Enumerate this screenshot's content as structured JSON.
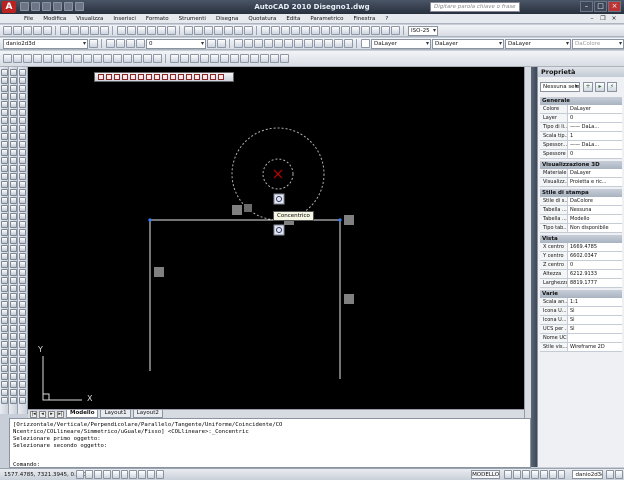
{
  "window": {
    "title": "AutoCAD 2010    Disegno1.dwg",
    "help_search_placeholder": "Digitare parola chiave o frase",
    "logo": "A"
  },
  "menu": [
    "File",
    "Modifica",
    "Visualizza",
    "Inserisci",
    "Formato",
    "Strumenti",
    "Disegna",
    "Quotatura",
    "Edita",
    "Parametrico",
    "Finestra",
    "?"
  ],
  "toolbars": {
    "workspace": "danio2d3d",
    "layer_state": "0",
    "layer_combo": "DaLayer",
    "linetype_combo": "DaLayer",
    "lineweight_combo": "DaLayer",
    "plotstyle_combo": "DaColore",
    "dimstyle": "ISO-25"
  },
  "drawing": {
    "tooltip": "Concentrico",
    "ucs_x": "X",
    "ucs_y": "Y",
    "tabs": [
      "Modello",
      "Layout1",
      "Layout2"
    ],
    "active_tab": "Modello"
  },
  "properties": {
    "title": "Proprietà",
    "selection": "Nessuna sele",
    "sections": [
      {
        "name": "Generale",
        "rows": [
          [
            "Colore",
            "DaLayer"
          ],
          [
            "Layer",
            "0"
          ],
          [
            "Tipo di li...",
            "—— DaLa..."
          ],
          [
            "Scala tip...",
            "1"
          ],
          [
            "Spessor...",
            "—— DaLa..."
          ],
          [
            "Spessore",
            "0"
          ]
        ]
      },
      {
        "name": "Visualizzazione 3D",
        "rows": [
          [
            "Materiale",
            "DaLayer"
          ],
          [
            "Visualizz...",
            "Proietta e ric..."
          ]
        ]
      },
      {
        "name": "Stile di stampa",
        "rows": [
          [
            "Stile di s...",
            "DaColore"
          ],
          [
            "Tabella ...",
            "Nessuna"
          ],
          [
            "Tabella ...",
            "Modello"
          ],
          [
            "Tipo tab...",
            "Non disponibile"
          ]
        ]
      },
      {
        "name": "Vista",
        "rows": [
          [
            "X centro",
            "1669.4785"
          ],
          [
            "Y centro",
            "6602.0347"
          ],
          [
            "Z centro",
            "0"
          ],
          [
            "Altezza",
            "6212.9133"
          ],
          [
            "Larghezza",
            "8819.1777"
          ]
        ]
      },
      {
        "name": "Varie",
        "rows": [
          [
            "Scala an...",
            "1:1"
          ],
          [
            "Icona U...",
            "Sì"
          ],
          [
            "Icona U...",
            "Sì"
          ],
          [
            "UCS per ...",
            "Sì"
          ],
          [
            "Nome UCS",
            ""
          ],
          [
            "Stile vis...",
            "Wireframe 2D"
          ]
        ]
      }
    ]
  },
  "command_line": {
    "history": [
      "[Orizzontale/Verticale/Perpendicolare/Parallelo/Tangente/Uniforme/Coincidente/CO",
      "Ncentrico/COLlineare/Simmetrico/uGuale/Fisso] <COLlineare>:_Concentric",
      "Selezionare primo oggetto:",
      "Selezionare secondo oggetto:"
    ],
    "prompt": "Comando:"
  },
  "status": {
    "coordinates": "1577.4785, 7321.3945, 0.0000",
    "model_button": "MODELLO",
    "workspace_name": "danio2d3d"
  },
  "colors": {
    "background": "#000000",
    "circle": "#b0b0b0",
    "center_marker": "#c00000",
    "grip": "#808080"
  }
}
